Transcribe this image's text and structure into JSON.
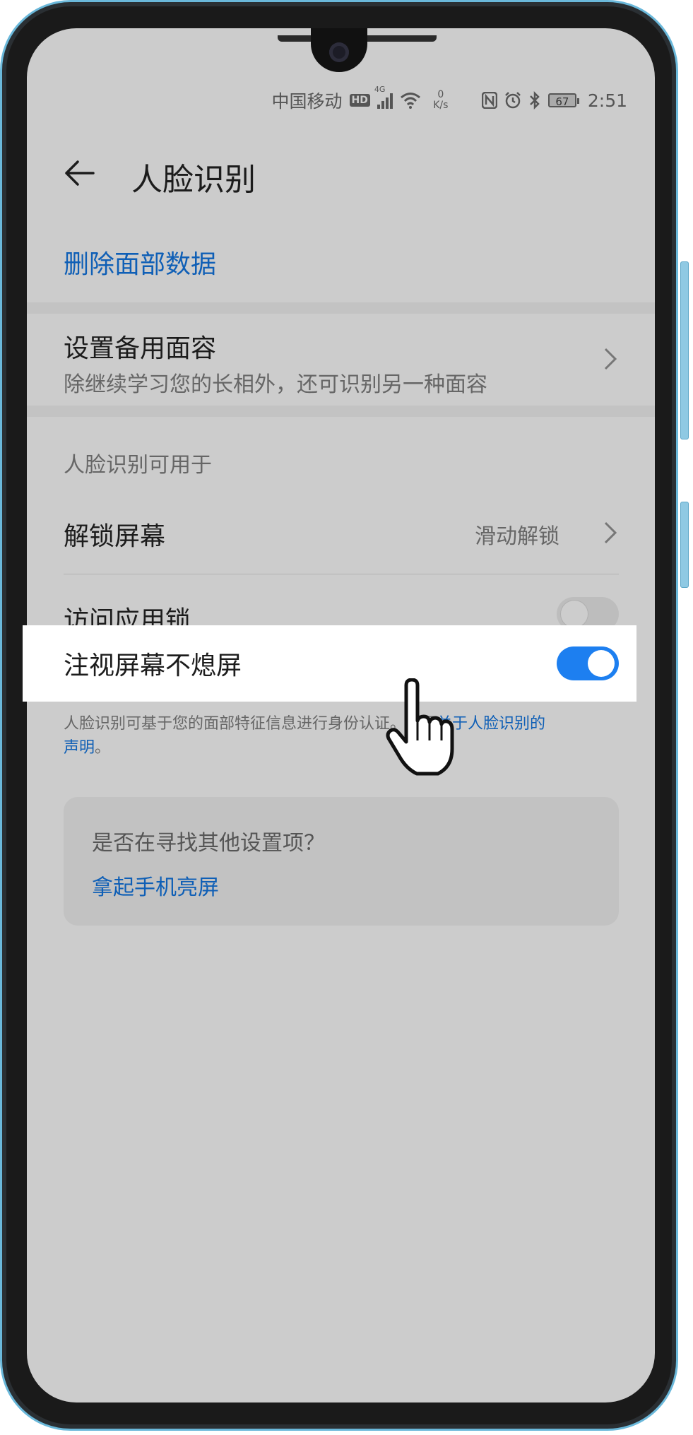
{
  "status_bar": {
    "carrier": "中国移动",
    "hd_badge": "HD",
    "network_type": "4G",
    "speed_value": "0",
    "speed_unit": "K/s",
    "battery_level": "67",
    "time": "2:51",
    "icons": [
      "signal-icon",
      "wifi-icon",
      "nfc-icon",
      "alarm-icon",
      "bluetooth-icon",
      "battery-icon"
    ]
  },
  "header": {
    "title": "人脸识别",
    "back_icon": "back-arrow-icon"
  },
  "delete_link": "删除面部数据",
  "alt_face": {
    "title": "设置备用面容",
    "subtitle": "除继续学习您的长相外，还可识别另一种面容"
  },
  "section_label": "人脸识别可用于",
  "unlock": {
    "title": "解锁屏幕",
    "value": "滑动解锁"
  },
  "app_lock": {
    "title": "访问应用锁",
    "toggle": "off"
  },
  "gaze": {
    "title": "注视屏幕不熄屏",
    "toggle": "on"
  },
  "footnote": {
    "text_before": "人脸识别可基于您的面部特征信息进行身份认证。了解",
    "link_1": "关于人脸识别的",
    "link_2": "声明",
    "text_after": "。"
  },
  "suggestion_card": {
    "title": "是否在寻找其他设置项？",
    "link": "拿起手机亮屏"
  },
  "colors": {
    "accent": "#0f5fb6",
    "toggle_on": "#1d7ff0",
    "screen_bg": "#cccccc"
  }
}
